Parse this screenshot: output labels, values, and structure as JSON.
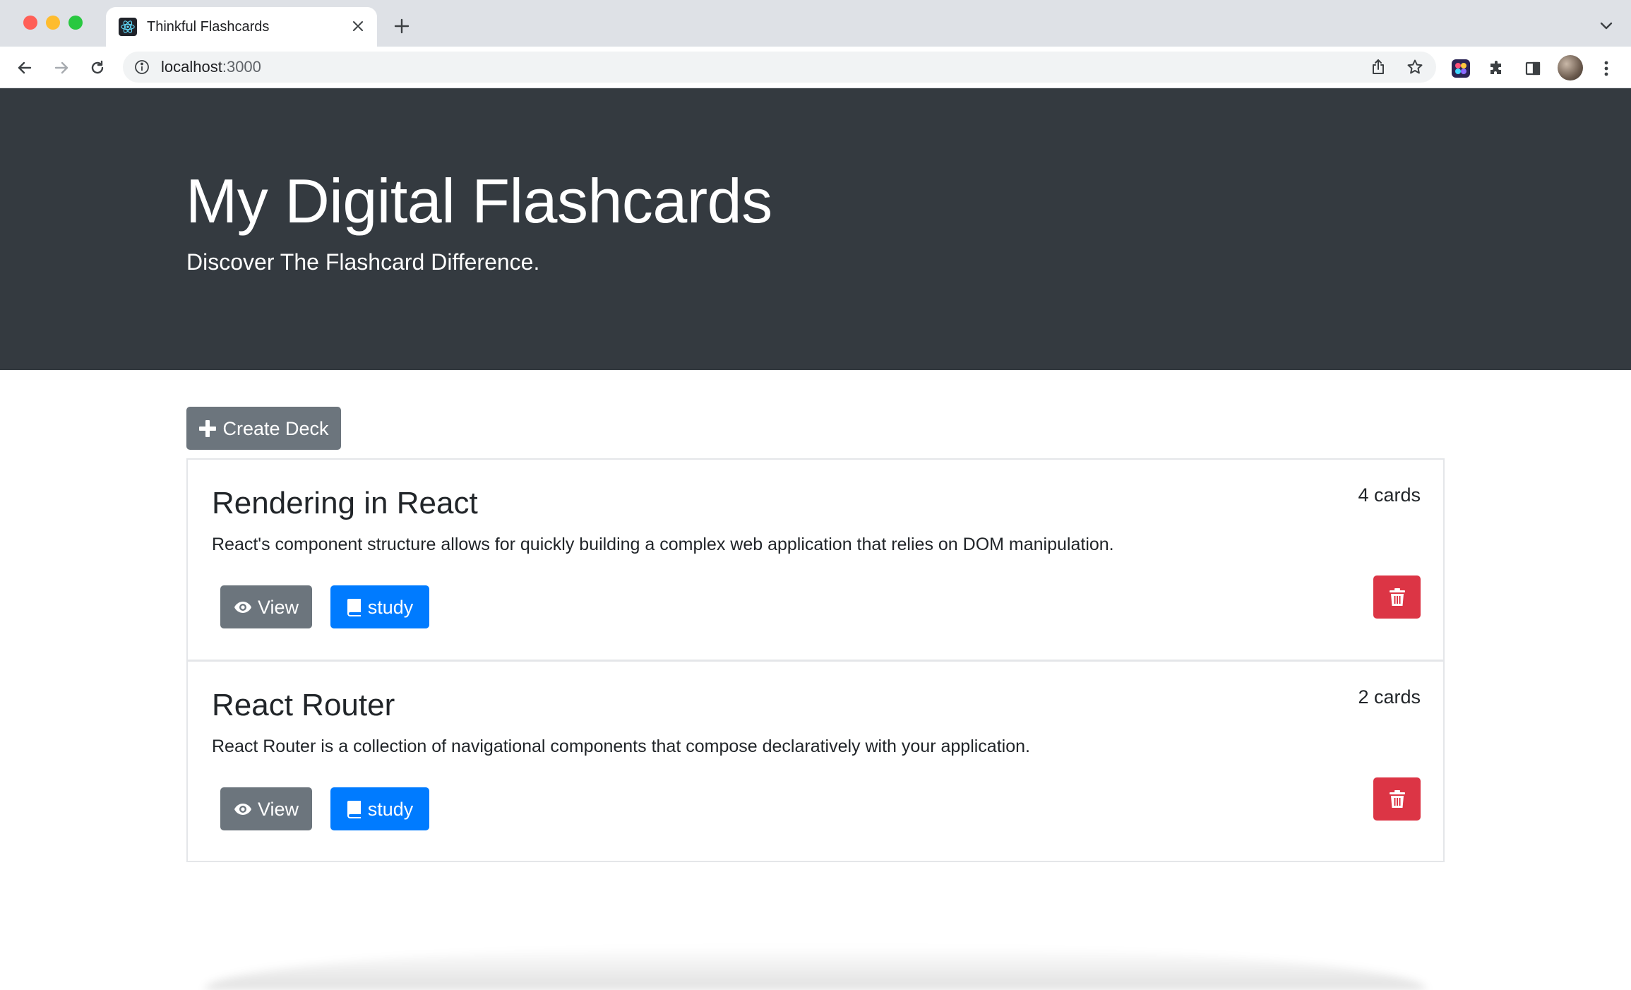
{
  "browser": {
    "tab_title": "Thinkful Flashcards",
    "url_host": "localhost",
    "url_port": ":3000"
  },
  "hero": {
    "title": "My Digital Flashcards",
    "subtitle": "Discover The Flashcard Difference."
  },
  "actions": {
    "create_deck_label": "Create Deck"
  },
  "decks": [
    {
      "name": "Rendering in React",
      "count": "4 cards",
      "description": "React's component structure allows for quickly building a complex web application that relies on DOM manipulation.",
      "view_label": "View",
      "study_label": "study"
    },
    {
      "name": "React Router",
      "count": "2 cards",
      "description": "React Router is a collection of navigational components that compose declaratively with your application.",
      "view_label": "View",
      "study_label": "study"
    }
  ],
  "colors": {
    "hero_bg": "#343a40",
    "secondary": "#6c757d",
    "primary": "#007bff",
    "danger": "#dc3545"
  }
}
